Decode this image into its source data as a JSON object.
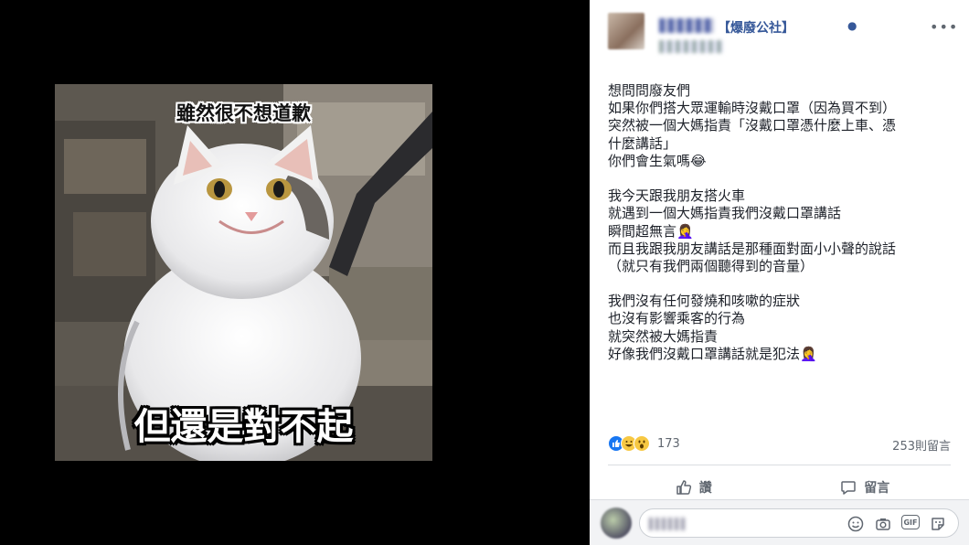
{
  "image": {
    "caption_top": "雖然很不想道歉",
    "caption_bottom": "但還是對不起"
  },
  "post": {
    "group_name": "【爆廢公社】",
    "body_lines": [
      "想問問廢友們",
      "如果你們搭大眾運輸時沒戴口罩（因為買不到）",
      "突然被一個大媽指責「沒戴口罩憑什麼上車、憑",
      "什麼講話」",
      "你們會生氣嗎😂",
      "",
      "我今天跟我朋友搭火車",
      "就遇到一個大媽指責我們沒戴口罩講話",
      "瞬間超無言🤦‍♀️",
      "而且我跟我朋友講話是那種面對面小小聲的說話",
      "（就只有我們兩個聽得到的音量）",
      "",
      "我們沒有任何發燒和咳嗽的症狀",
      "也沒有影響乘客的行為",
      "就突然被大媽指責",
      "好像我們沒戴口罩講話就是犯法🤦‍♀️"
    ]
  },
  "stats": {
    "reaction_count": "173",
    "comment_count": "253則留言"
  },
  "actions": {
    "like_label": "讚",
    "comment_label": "留言"
  },
  "colors": {
    "link": "#365899",
    "like_blue": "#1877f2",
    "text": "#1d2129",
    "muted": "#606770"
  }
}
